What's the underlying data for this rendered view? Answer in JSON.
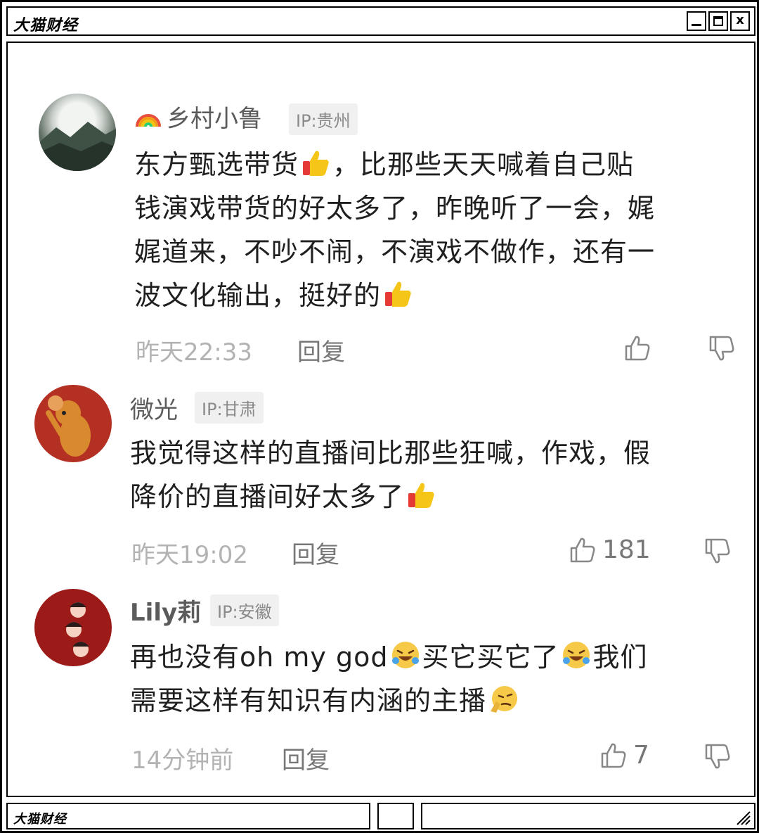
{
  "window": {
    "title": "大猫财经",
    "buttons": [
      "minimize",
      "maximize",
      "close"
    ]
  },
  "comments": [
    {
      "username": "乡村小鲁",
      "username_prefix_icon": "rainbow-emoji",
      "ip": "IP:贵州",
      "avatar": "mountain-fog-photo",
      "lines": [
        "东方甄选带货",
        "，比那些天天喊着自己贴",
        "钱演戏带货的好太多了，昨晚听了一会，娓",
        "娓道来，不吵不闹，不演戏不做作，还有一",
        "波文化输出，挺好的"
      ],
      "time": "昨天22:33",
      "reply": "回复",
      "likes": ""
    },
    {
      "username": "微光",
      "ip": "IP:甘肃",
      "avatar": "cartoon-mouse",
      "lines": [
        "我觉得这样的直播间比那些狂喊，作戏，假",
        "降价的直播间好太多了"
      ],
      "time": "昨天19:02",
      "reply": "回复",
      "likes": "181"
    },
    {
      "username": "Lily莉",
      "ip": "IP:安徽",
      "avatar": "new-year-dolls",
      "lines": [
        "再也没有oh my god",
        "买它买它了",
        "我们",
        "需要这样有知识有内涵的主播"
      ],
      "time": "14分钟前",
      "reply": "回复",
      "likes": "7"
    }
  ],
  "statusbar": {
    "title": "大猫财经"
  },
  "colors": {
    "frame": "#000000",
    "text": "#1f1f1f",
    "meta": "#b3b3b3",
    "thumbs_up_emoji": "#f5c518"
  }
}
